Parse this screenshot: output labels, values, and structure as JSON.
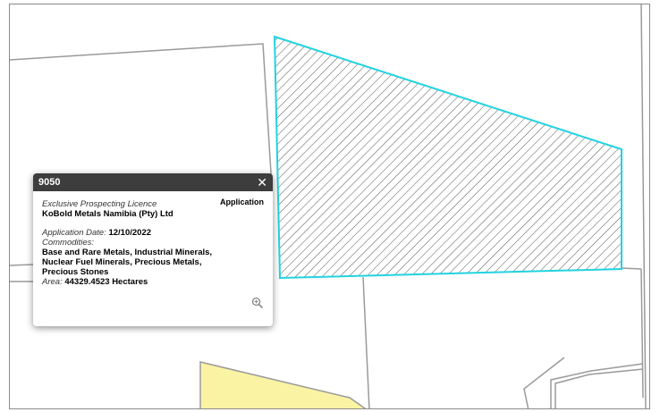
{
  "popup": {
    "title": "9050",
    "close_glyph": "✕",
    "licence_type": "Exclusive Prospecting Licence",
    "status": "Application",
    "holder": "KoBold Metals Namibia (Pty) Ltd",
    "application_date_label": "Application Date:",
    "application_date": "12/10/2022",
    "commodities_label": "Commodities:",
    "commodities_lines": [
      "Base and Rare Metals, Industrial Minerals,",
      "Nuclear Fuel Minerals, Precious Metals,",
      "Precious Stones"
    ],
    "area_label": "Area:",
    "area_value": "44329.4523 Hectares",
    "zoom_icon": "zoom-in-icon"
  },
  "map": {
    "selected_parcel_outline_color": "#22d3e0",
    "hatch_color": "#555555",
    "boundary_color": "#9a9a9a",
    "highlight_fill_color": "#fbf3a4"
  }
}
